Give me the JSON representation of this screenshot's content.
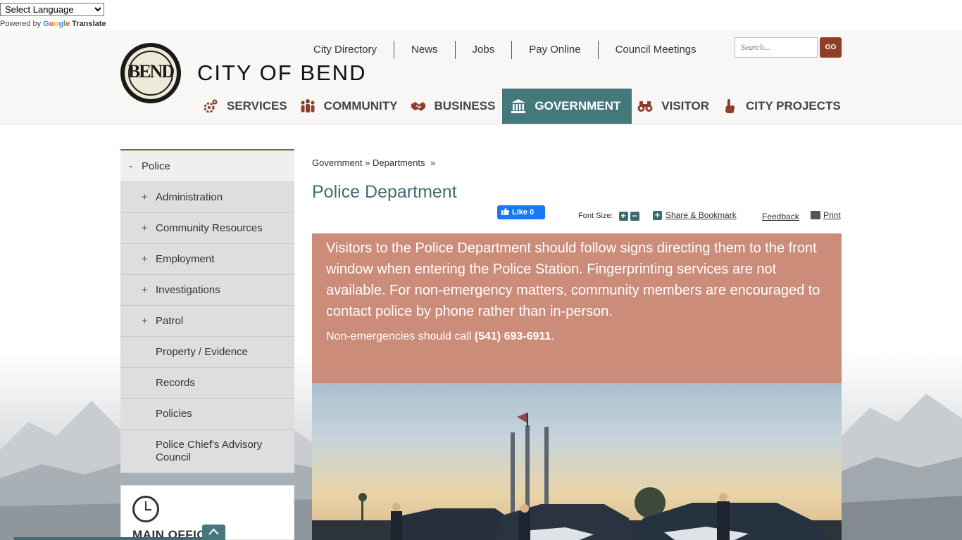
{
  "translate": {
    "select_value": "Select Language",
    "powered_by": "Powered by",
    "google": [
      "G",
      "o",
      "o",
      "g",
      "l",
      "e"
    ],
    "translate_label": "Translate"
  },
  "header": {
    "logo_letters": "BEND",
    "site_title": "CITY OF BEND",
    "utility_links": [
      "City Directory",
      "News",
      "Jobs",
      "Pay Online",
      "Council Meetings"
    ],
    "search_placeholder": "Search...",
    "search_button": "GO",
    "nav": [
      {
        "label": "SERVICES",
        "icon": "gears-icon"
      },
      {
        "label": "COMMUNITY",
        "icon": "people-icon"
      },
      {
        "label": "BUSINESS",
        "icon": "handshake-icon"
      },
      {
        "label": "GOVERNMENT",
        "icon": "government-building-icon",
        "active": true
      },
      {
        "label": "VISITOR",
        "icon": "binoculars-icon"
      },
      {
        "label": "CITY PROJECTS",
        "icon": "pointer-hand-icon"
      }
    ],
    "accent_color": "#44787a",
    "brand_color": "#8f3e2b"
  },
  "sidebar": {
    "heading_sign": "-",
    "heading": "Police",
    "items": [
      {
        "sign": "+",
        "label": "Administration"
      },
      {
        "sign": "+",
        "label": "Community Resources"
      },
      {
        "sign": "+",
        "label": "Employment"
      },
      {
        "sign": "+",
        "label": "Investigations"
      },
      {
        "sign": "+",
        "label": "Patrol"
      },
      {
        "sign": "",
        "label": "Property / Evidence"
      },
      {
        "sign": "",
        "label": "Records"
      },
      {
        "sign": "",
        "label": "Policies"
      },
      {
        "sign": "",
        "label": "Police Chief's Advisory Council"
      }
    ],
    "hours_title": "MAIN OFFIC"
  },
  "content": {
    "breadcrumb": [
      "Government",
      "»",
      "Departments",
      "»"
    ],
    "page_title": "Police Department",
    "fb_like": "Like 0",
    "font_size_label": "Font Size:",
    "share_label": "Share & Bookmark",
    "feedback_label": "Feedback",
    "print_label": "Print",
    "notice_text": "Visitors to the Police Department should follow signs directing them to the front window when entering the Police Station. Fingerprinting services are not available. For non-emergency matters, community members are encouraged to contact police by phone rather than in-person.",
    "notice_call_prefix": "Non-emergencies should call ",
    "notice_phone": "(541) 693-6911",
    "notice_call_suffix": ".",
    "notice_color": "#cc8c7a"
  }
}
